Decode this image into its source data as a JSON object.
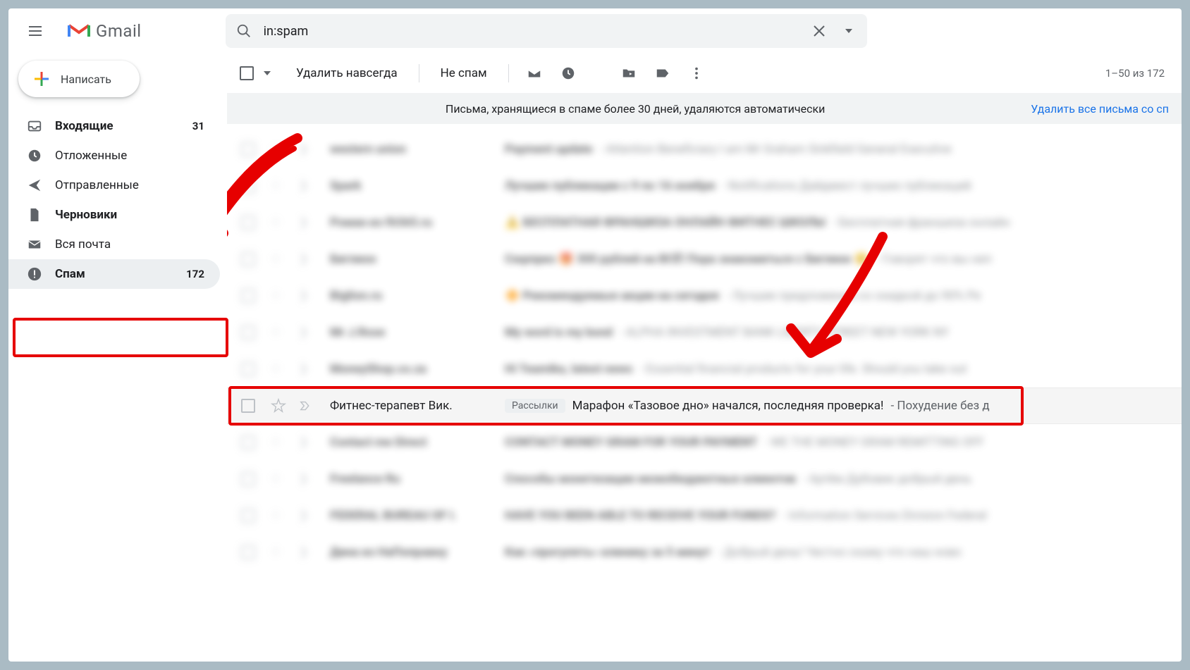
{
  "header": {
    "app_name": "Gmail",
    "search_value": "in:spam"
  },
  "compose_label": "Написать",
  "sidebar": {
    "items": [
      {
        "label": "Входящие",
        "count": "31",
        "bold": true
      },
      {
        "label": "Отложенные",
        "count": "",
        "bold": false
      },
      {
        "label": "Отправленные",
        "count": "",
        "bold": false
      },
      {
        "label": "Черновики",
        "count": "",
        "bold": true
      },
      {
        "label": "Вся почта",
        "count": "",
        "bold": false
      },
      {
        "label": "Спам",
        "count": "172",
        "bold": true,
        "active": true
      }
    ]
  },
  "toolbar": {
    "delete_forever": "Удалить навсегда",
    "not_spam": "Не спам",
    "counter": "1–50 из 172"
  },
  "banner": {
    "message": "Письма, хранящиеся в спаме более 30 дней, удаляются автоматически",
    "link": "Удалить все письма со сп"
  },
  "focus_row": {
    "sender": "Фитнес-терапевт Вик.",
    "tag": "Рассылки",
    "subject": "Марафон «Тазовое дно» начался, последняя проверка!",
    "snippet": " - Похудение без д"
  }
}
